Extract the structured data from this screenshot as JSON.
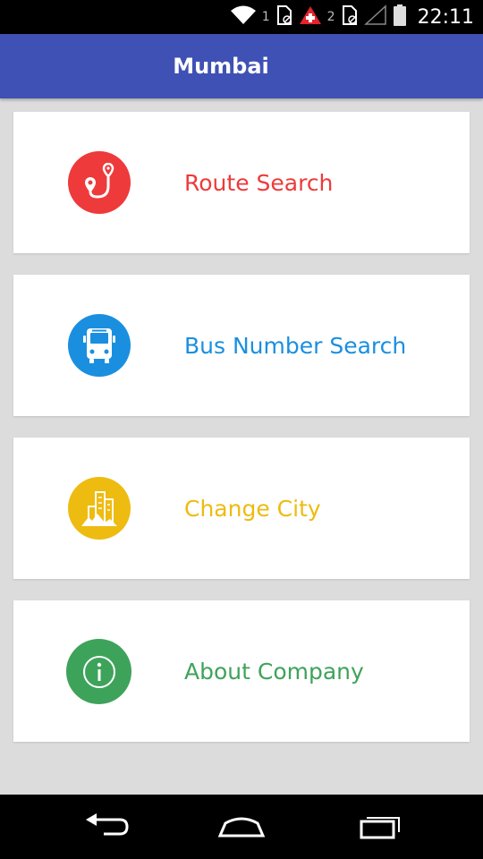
{
  "status_bar": {
    "sim1_label": "1",
    "sim2_label": "2",
    "time": "22:11",
    "icons": [
      "wifi-icon",
      "sim-card-icon",
      "alert-icon",
      "sim-card-icon",
      "signal-icon",
      "battery-icon"
    ]
  },
  "app_bar": {
    "title": "Mumbai",
    "color": "#3f51b5"
  },
  "menu": {
    "items": [
      {
        "label": "Route Search",
        "icon": "route-pin-icon",
        "color": "#ee3a3a"
      },
      {
        "label": "Bus Number Search",
        "icon": "bus-icon",
        "color": "#1a8fe0"
      },
      {
        "label": "Change City",
        "icon": "city-buildings-icon",
        "color": "#eebb10"
      },
      {
        "label": "About Company",
        "icon": "info-icon",
        "color": "#3ea35a"
      }
    ]
  },
  "nav_bar": {
    "icons": [
      "back-icon",
      "home-icon",
      "recent-apps-icon"
    ]
  }
}
